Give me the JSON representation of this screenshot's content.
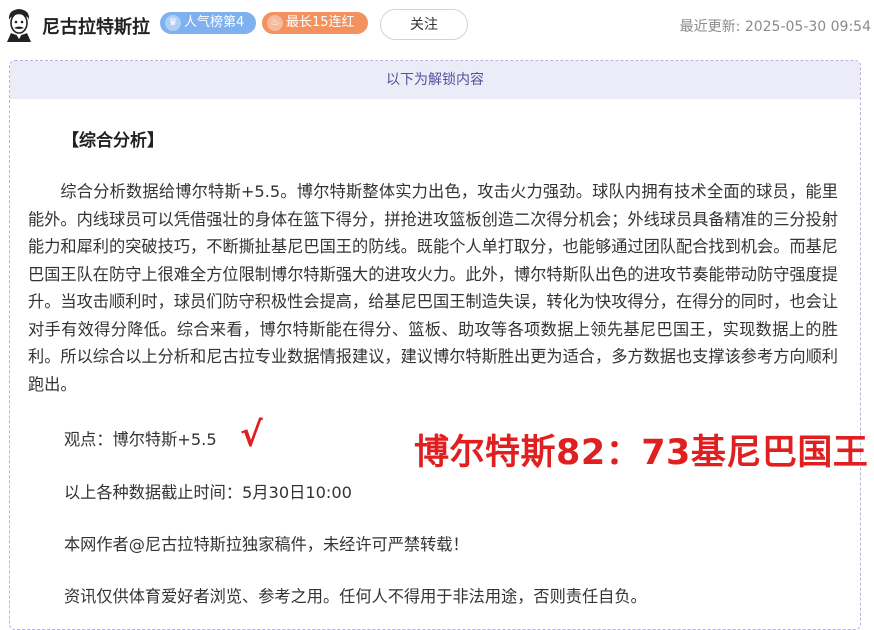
{
  "header": {
    "author_name": "尼古拉特斯拉",
    "badges": [
      {
        "label": "人气榜第4",
        "icon": "crown-icon",
        "color": "#7fb0f0"
      },
      {
        "label": "最长15连红",
        "icon": "flame-icon",
        "color": "#f3925e"
      }
    ],
    "follow_label": "关注",
    "updated_label": "最近更新:",
    "updated_time": "2025-05-30 09:54"
  },
  "content": {
    "unlock_notice": "以下为解锁内容",
    "section_title": "【综合分析】",
    "paragraph": "综合分析数据给博尔特斯+5.5。博尔特斯整体实力出色，攻击火力强劲。球队内拥有技术全面的球员，能里能外。内线球员可以凭借强壮的身体在篮下得分，拼抢进攻篮板创造二次得分机会；外线球员具备精准的三分投射能力和犀利的突破技巧，不断撕扯基尼巴国王的防线。既能个人单打取分，也能够通过团队配合找到机会。而基尼巴国王队在防守上很难全方位限制博尔特斯强大的进攻火力。此外，博尔特斯队出色的进攻节奏能带动防守强度提升。当攻击顺利时，球员们防守积极性会提高，给基尼巴国王制造失误，转化为快攻得分，在得分的同时，也会让对手有效得分降低。综合来看，博尔特斯能在得分、篮板、助攻等各项数据上领先基尼巴国王，实现数据上的胜利。所以综合以上分析和尼古拉专业数据情报建议，建议博尔特斯胜出更为适合，多方数据也支撑该参考方向顺利跑出。",
    "viewpoint": "观点：博尔特斯+5.5",
    "check_mark": "√",
    "final_score": "博尔特斯82：73基尼巴国王",
    "deadline": "以上各种数据截止时间：5月30日10:00",
    "copyright": "本网作者@尼古拉特斯拉独家稿件，未经许可严禁转载！",
    "disclaimer": "资讯仅供体育爱好者浏览、参考之用。任何人不得用于非法用途，否则责任自负。"
  },
  "colors": {
    "accent_red": "#e02020",
    "unlock_bar_bg": "#ecebf8",
    "unlock_text": "#5a4f9e"
  }
}
